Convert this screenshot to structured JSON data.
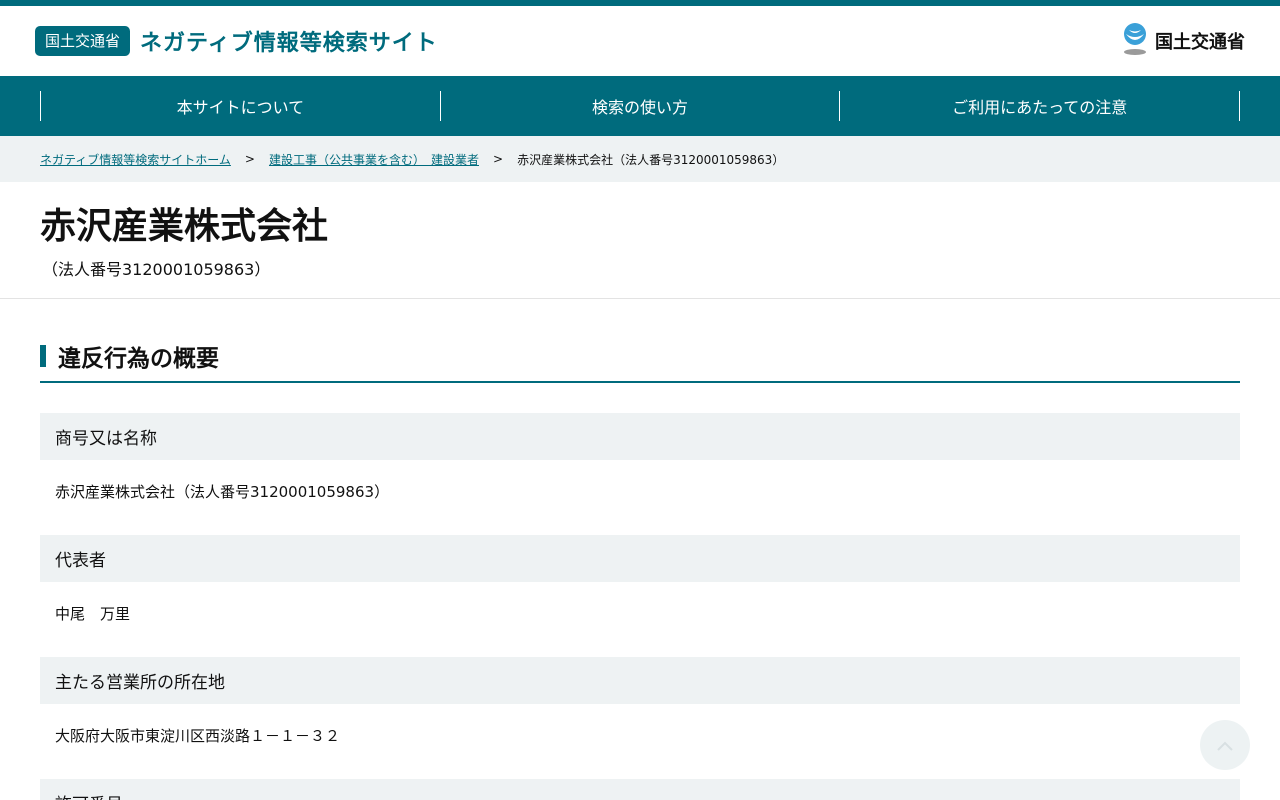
{
  "header": {
    "badge": "国土交通省",
    "site_title": "ネガティブ情報等検索サイト",
    "logo_text": "国土交通省",
    "logo_icon": "mlit-logo-icon"
  },
  "nav": {
    "items": [
      {
        "label": "本サイトについて"
      },
      {
        "label": "検索の使い方"
      },
      {
        "label": "ご利用にあたっての注意"
      }
    ]
  },
  "breadcrumb": {
    "home": "ネガティブ情報等検索サイトホーム",
    "category": "建設工事（公共事業を含む）　建設業者",
    "current": "赤沢産業株式会社（法人番号3120001059863）",
    "separator": ">"
  },
  "company": {
    "name": "赤沢産業株式会社",
    "corp_number": "（法人番号3120001059863）"
  },
  "section": {
    "title": "違反行為の概要"
  },
  "fields": [
    {
      "label": "商号又は名称",
      "value": "赤沢産業株式会社（法人番号3120001059863）"
    },
    {
      "label": "代表者",
      "value": "中尾　万里"
    },
    {
      "label": "主たる営業所の所在地",
      "value": "大阪府大阪市東淀川区西淡路１－１－３２"
    },
    {
      "label": "許可番号",
      "value": ""
    }
  ],
  "colors": {
    "accent": "#006b7d",
    "band": "#eef2f3"
  }
}
